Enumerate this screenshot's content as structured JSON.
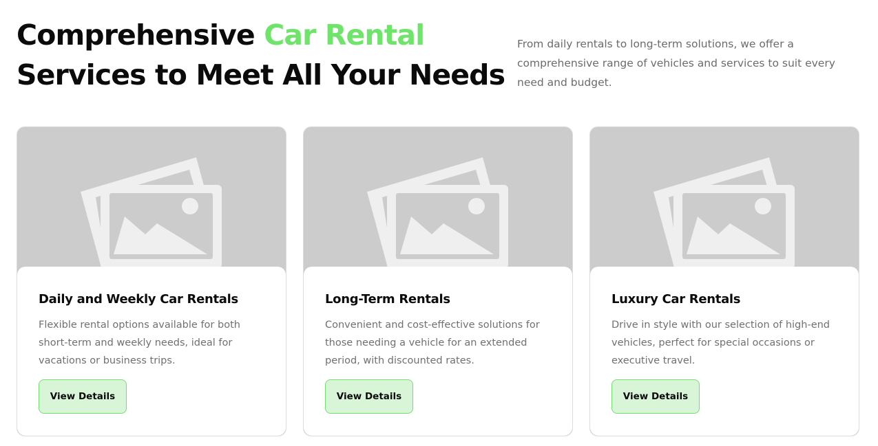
{
  "header": {
    "title_part1": "Comprehensive ",
    "title_accent": "Car Rental",
    "title_part2": "Services to Meet All Your Needs",
    "description": "From daily rentals to long-term solutions, we offer a comprehensive range of vehicles and services to suit every need and budget.",
    "accent_color": "#6ee46a"
  },
  "cards": [
    {
      "image_icon": "image-placeholder-icon",
      "title": "Daily and Weekly Car Rentals",
      "description": "Flexible rental options available for both short-term and weekly needs, ideal for vacations or business trips.",
      "button_label": "View Details"
    },
    {
      "image_icon": "image-placeholder-icon",
      "title": "Long-Term Rentals",
      "description": "Convenient and cost-effective solutions for those needing a vehicle for an extended period, with discounted rates.",
      "button_label": "View Details"
    },
    {
      "image_icon": "image-placeholder-icon",
      "title": "Luxury Car Rentals",
      "description": "Drive in style with our selection of high-end vehicles, perfect for special occasions or executive travel.",
      "button_label": "View Details"
    }
  ],
  "colors": {
    "button_bg": "#d8f5d7",
    "button_border": "#74e06e",
    "placeholder_bg": "#cccccc"
  }
}
